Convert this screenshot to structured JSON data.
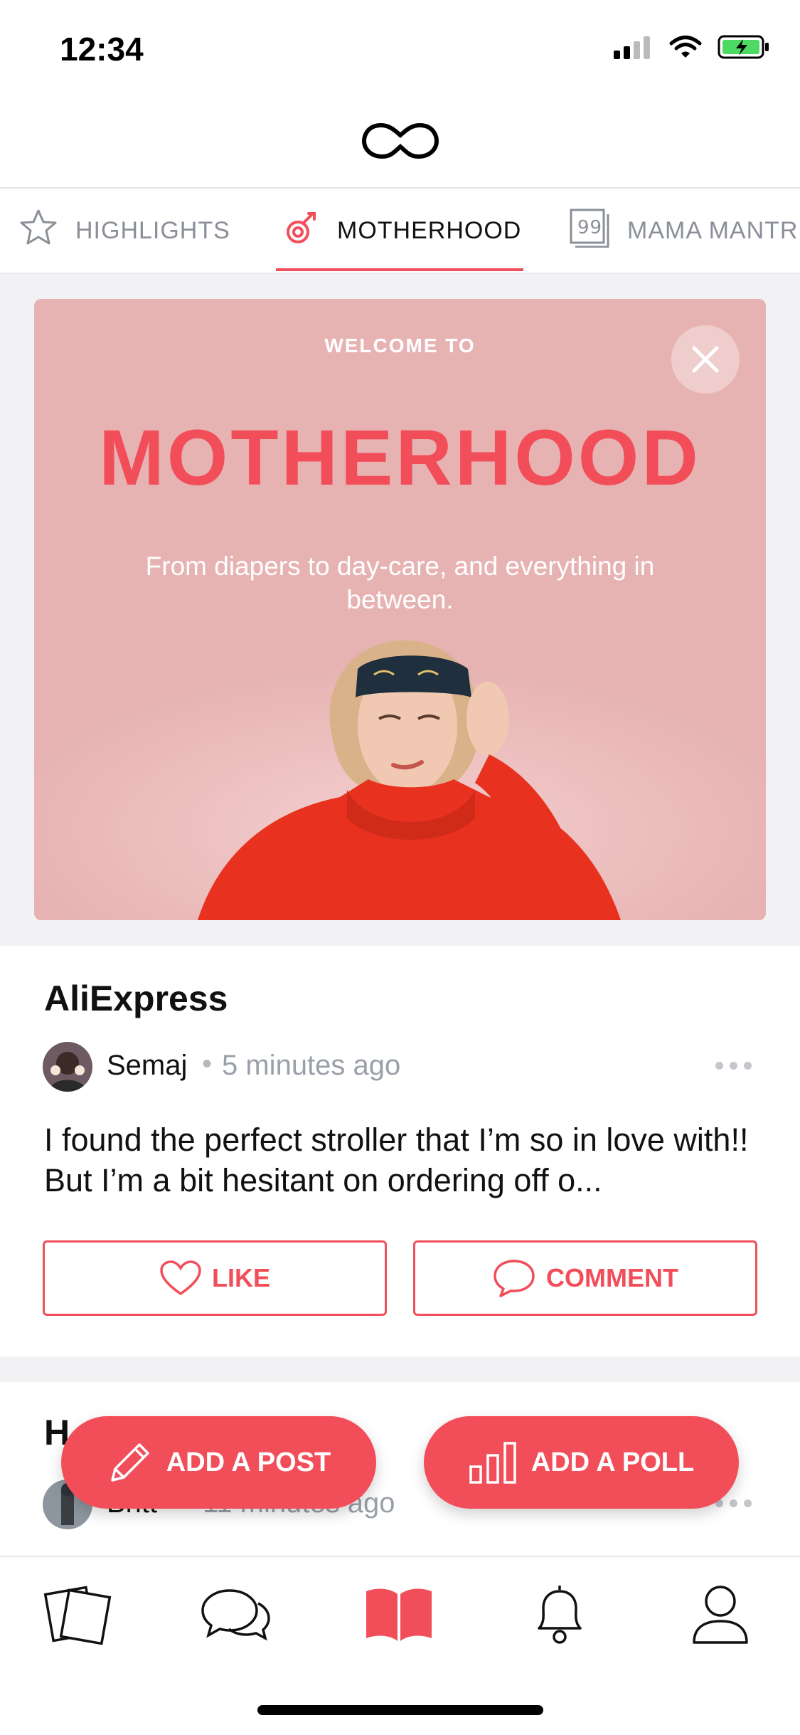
{
  "status_bar": {
    "time": "12:34"
  },
  "tabs": [
    {
      "label": "HIGHLIGHTS",
      "icon": "star-icon",
      "active": false
    },
    {
      "label": "MOTHERHOOD",
      "icon": "motherhood-icon",
      "active": true
    },
    {
      "label": "MAMA MANTR",
      "icon": "quote-icon",
      "active": false
    }
  ],
  "banner": {
    "welcome": "WELCOME TO",
    "title": "MOTHERHOOD",
    "subtitle": "From diapers to day-care, and everything in between."
  },
  "posts": [
    {
      "title": "AliExpress",
      "author": "Semaj",
      "time_ago": "5 minutes ago",
      "body": "I found the perfect stroller that I’m so in love with!! But I’m a bit hesitant on ordering off o...",
      "like_label": "LIKE",
      "comment_label": "COMMENT"
    },
    {
      "title": "H",
      "author": "Britt",
      "time_ago": "11 minutes ago"
    }
  ],
  "fab": {
    "add_post": "ADD A POST",
    "add_poll": "ADD A POLL"
  },
  "bottom_nav": [
    "feed-icon",
    "chat-icon",
    "book-icon",
    "bell-icon",
    "profile-icon"
  ],
  "colors": {
    "accent": "#f24e5a",
    "banner_bg": "#e6b3b2",
    "muted": "#9aa0a8"
  }
}
